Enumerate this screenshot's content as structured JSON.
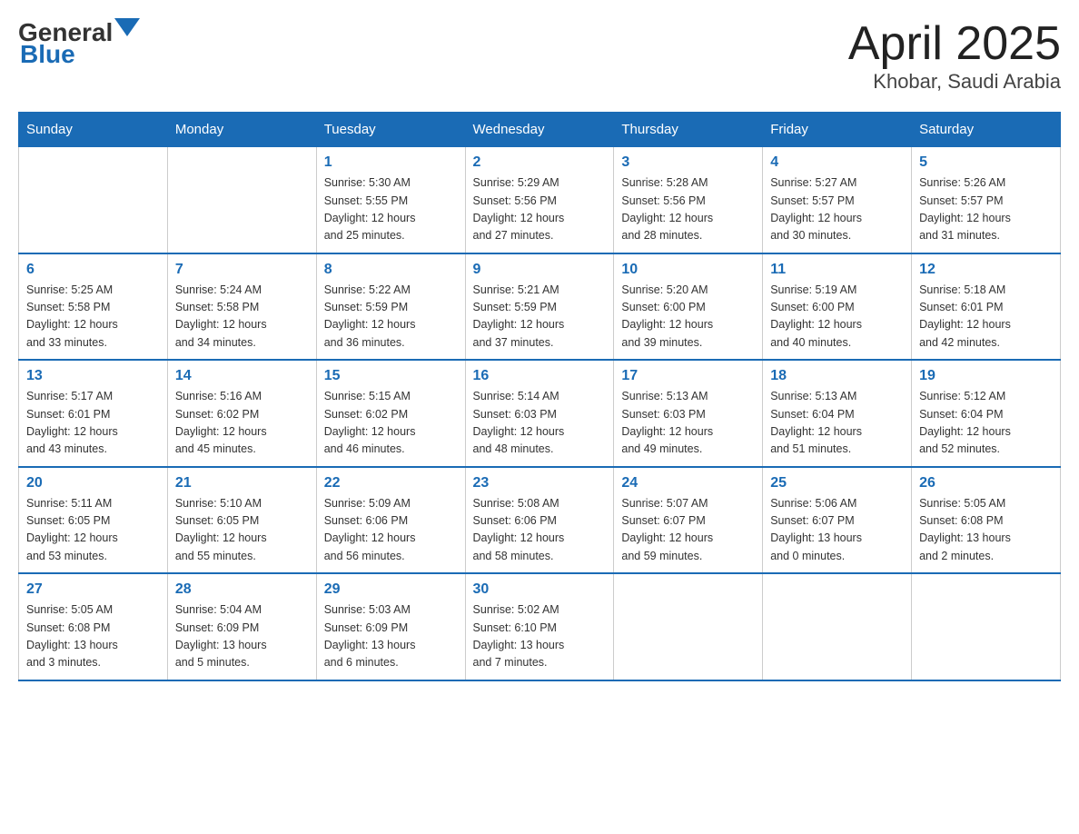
{
  "logo": {
    "text_general": "General",
    "text_blue": "Blue"
  },
  "title": "April 2025",
  "subtitle": "Khobar, Saudi Arabia",
  "days_of_week": [
    "Sunday",
    "Monday",
    "Tuesday",
    "Wednesday",
    "Thursday",
    "Friday",
    "Saturday"
  ],
  "weeks": [
    [
      {
        "day": "",
        "info": ""
      },
      {
        "day": "",
        "info": ""
      },
      {
        "day": "1",
        "info": "Sunrise: 5:30 AM\nSunset: 5:55 PM\nDaylight: 12 hours\nand 25 minutes."
      },
      {
        "day": "2",
        "info": "Sunrise: 5:29 AM\nSunset: 5:56 PM\nDaylight: 12 hours\nand 27 minutes."
      },
      {
        "day": "3",
        "info": "Sunrise: 5:28 AM\nSunset: 5:56 PM\nDaylight: 12 hours\nand 28 minutes."
      },
      {
        "day": "4",
        "info": "Sunrise: 5:27 AM\nSunset: 5:57 PM\nDaylight: 12 hours\nand 30 minutes."
      },
      {
        "day": "5",
        "info": "Sunrise: 5:26 AM\nSunset: 5:57 PM\nDaylight: 12 hours\nand 31 minutes."
      }
    ],
    [
      {
        "day": "6",
        "info": "Sunrise: 5:25 AM\nSunset: 5:58 PM\nDaylight: 12 hours\nand 33 minutes."
      },
      {
        "day": "7",
        "info": "Sunrise: 5:24 AM\nSunset: 5:58 PM\nDaylight: 12 hours\nand 34 minutes."
      },
      {
        "day": "8",
        "info": "Sunrise: 5:22 AM\nSunset: 5:59 PM\nDaylight: 12 hours\nand 36 minutes."
      },
      {
        "day": "9",
        "info": "Sunrise: 5:21 AM\nSunset: 5:59 PM\nDaylight: 12 hours\nand 37 minutes."
      },
      {
        "day": "10",
        "info": "Sunrise: 5:20 AM\nSunset: 6:00 PM\nDaylight: 12 hours\nand 39 minutes."
      },
      {
        "day": "11",
        "info": "Sunrise: 5:19 AM\nSunset: 6:00 PM\nDaylight: 12 hours\nand 40 minutes."
      },
      {
        "day": "12",
        "info": "Sunrise: 5:18 AM\nSunset: 6:01 PM\nDaylight: 12 hours\nand 42 minutes."
      }
    ],
    [
      {
        "day": "13",
        "info": "Sunrise: 5:17 AM\nSunset: 6:01 PM\nDaylight: 12 hours\nand 43 minutes."
      },
      {
        "day": "14",
        "info": "Sunrise: 5:16 AM\nSunset: 6:02 PM\nDaylight: 12 hours\nand 45 minutes."
      },
      {
        "day": "15",
        "info": "Sunrise: 5:15 AM\nSunset: 6:02 PM\nDaylight: 12 hours\nand 46 minutes."
      },
      {
        "day": "16",
        "info": "Sunrise: 5:14 AM\nSunset: 6:03 PM\nDaylight: 12 hours\nand 48 minutes."
      },
      {
        "day": "17",
        "info": "Sunrise: 5:13 AM\nSunset: 6:03 PM\nDaylight: 12 hours\nand 49 minutes."
      },
      {
        "day": "18",
        "info": "Sunrise: 5:13 AM\nSunset: 6:04 PM\nDaylight: 12 hours\nand 51 minutes."
      },
      {
        "day": "19",
        "info": "Sunrise: 5:12 AM\nSunset: 6:04 PM\nDaylight: 12 hours\nand 52 minutes."
      }
    ],
    [
      {
        "day": "20",
        "info": "Sunrise: 5:11 AM\nSunset: 6:05 PM\nDaylight: 12 hours\nand 53 minutes."
      },
      {
        "day": "21",
        "info": "Sunrise: 5:10 AM\nSunset: 6:05 PM\nDaylight: 12 hours\nand 55 minutes."
      },
      {
        "day": "22",
        "info": "Sunrise: 5:09 AM\nSunset: 6:06 PM\nDaylight: 12 hours\nand 56 minutes."
      },
      {
        "day": "23",
        "info": "Sunrise: 5:08 AM\nSunset: 6:06 PM\nDaylight: 12 hours\nand 58 minutes."
      },
      {
        "day": "24",
        "info": "Sunrise: 5:07 AM\nSunset: 6:07 PM\nDaylight: 12 hours\nand 59 minutes."
      },
      {
        "day": "25",
        "info": "Sunrise: 5:06 AM\nSunset: 6:07 PM\nDaylight: 13 hours\nand 0 minutes."
      },
      {
        "day": "26",
        "info": "Sunrise: 5:05 AM\nSunset: 6:08 PM\nDaylight: 13 hours\nand 2 minutes."
      }
    ],
    [
      {
        "day": "27",
        "info": "Sunrise: 5:05 AM\nSunset: 6:08 PM\nDaylight: 13 hours\nand 3 minutes."
      },
      {
        "day": "28",
        "info": "Sunrise: 5:04 AM\nSunset: 6:09 PM\nDaylight: 13 hours\nand 5 minutes."
      },
      {
        "day": "29",
        "info": "Sunrise: 5:03 AM\nSunset: 6:09 PM\nDaylight: 13 hours\nand 6 minutes."
      },
      {
        "day": "30",
        "info": "Sunrise: 5:02 AM\nSunset: 6:10 PM\nDaylight: 13 hours\nand 7 minutes."
      },
      {
        "day": "",
        "info": ""
      },
      {
        "day": "",
        "info": ""
      },
      {
        "day": "",
        "info": ""
      }
    ]
  ]
}
